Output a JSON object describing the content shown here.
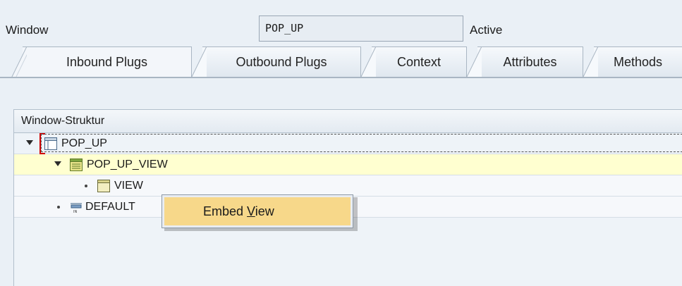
{
  "header": {
    "window_label": "Window",
    "window_name": "POP_UP",
    "status": "Active"
  },
  "tabs": [
    {
      "label": "Inbound Plugs",
      "active": true
    },
    {
      "label": "Outbound Plugs",
      "active": false
    },
    {
      "label": "Context",
      "active": false
    },
    {
      "label": "Attributes",
      "active": false
    },
    {
      "label": "Methods",
      "active": false
    }
  ],
  "tree": {
    "title": "Window-Struktur",
    "nodes": [
      {
        "label": "POP_UP",
        "icon": "window-icon"
      },
      {
        "label": "POP_UP_VIEW",
        "icon": "view-icon"
      },
      {
        "label": "VIEW",
        "icon": "view-container-icon"
      },
      {
        "label": "DEFAULT",
        "icon": "inbound-plug-icon"
      }
    ]
  },
  "context_menu": {
    "item_prefix": "Embed ",
    "item_underlined": "V",
    "item_suffix": "iew"
  },
  "colors": {
    "highlight_row": "#ffffd0",
    "menu_item": "#f7d88a",
    "focus_mark": "#d00000"
  }
}
